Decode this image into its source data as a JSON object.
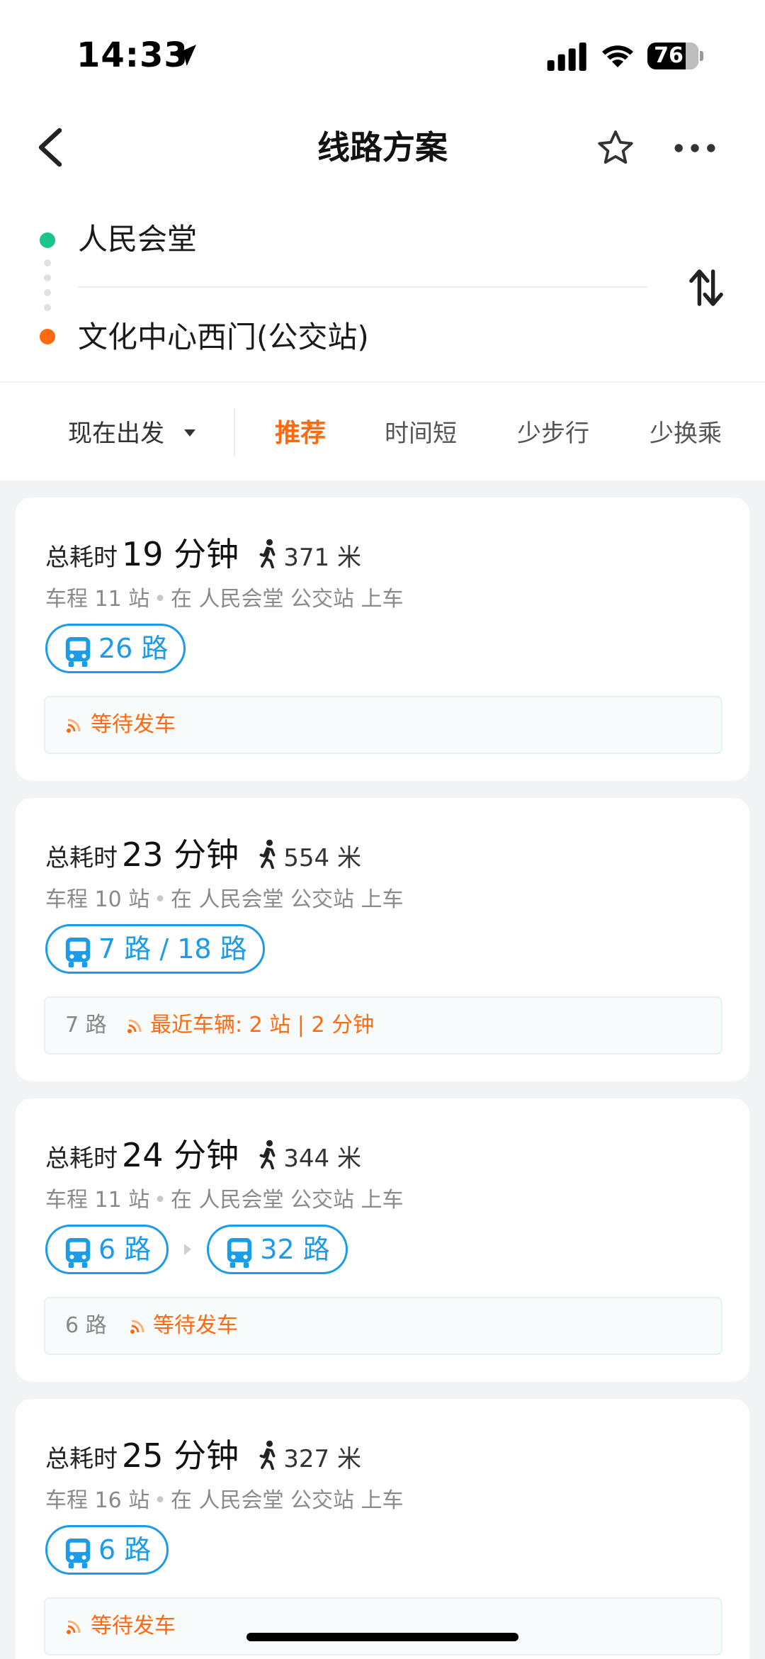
{
  "status_bar": {
    "time": "14:33",
    "battery": "76"
  },
  "header": {
    "title": "线路方案"
  },
  "route": {
    "origin": "人民会堂",
    "destination": "文化中心西门(公交站)"
  },
  "filters": {
    "depart": "现在出发",
    "tabs": [
      {
        "label": "推荐",
        "active": true
      },
      {
        "label": "时间短",
        "active": false
      },
      {
        "label": "少步行",
        "active": false
      },
      {
        "label": "少换乘",
        "active": false
      }
    ]
  },
  "total_label": "总耗时",
  "plans": [
    {
      "minutes": "19 分钟",
      "walk": "371 米",
      "stops": "车程 11 站",
      "board": "在 人民会堂 公交站 上车",
      "routes": [
        "26 路"
      ],
      "line": "",
      "status": "等待发车"
    },
    {
      "minutes": "23 分钟",
      "walk": "554 米",
      "stops": "车程 10 站",
      "board": "在 人民会堂 公交站 上车",
      "routes": [
        "7 路 / 18 路"
      ],
      "line": "7 路",
      "status": "最近车辆: 2 站 | 2 分钟"
    },
    {
      "minutes": "24 分钟",
      "walk": "344 米",
      "stops": "车程 11 站",
      "board": "在 人民会堂 公交站 上车",
      "routes": [
        "6 路",
        "32 路"
      ],
      "line": "6 路",
      "status": "等待发车"
    },
    {
      "minutes": "25 分钟",
      "walk": "327 米",
      "stops": "车程 16 站",
      "board": "在 人民会堂 公交站 上车",
      "routes": [
        "6 路"
      ],
      "line": "",
      "status": "等待发车"
    }
  ],
  "colors": {
    "accent": "#ff6a10",
    "bus_blue": "#1b9be8",
    "start_dot": "#19c58a",
    "end_dot": "#ff6a10"
  },
  "icons": [
    "location-arrow-icon",
    "signal-icon",
    "wifi-icon",
    "back-icon",
    "star-icon",
    "more-icon",
    "swap-icon",
    "caret-down-icon",
    "walk-icon",
    "bus-icon",
    "realtime-icon",
    "chevron-right-icon"
  ]
}
